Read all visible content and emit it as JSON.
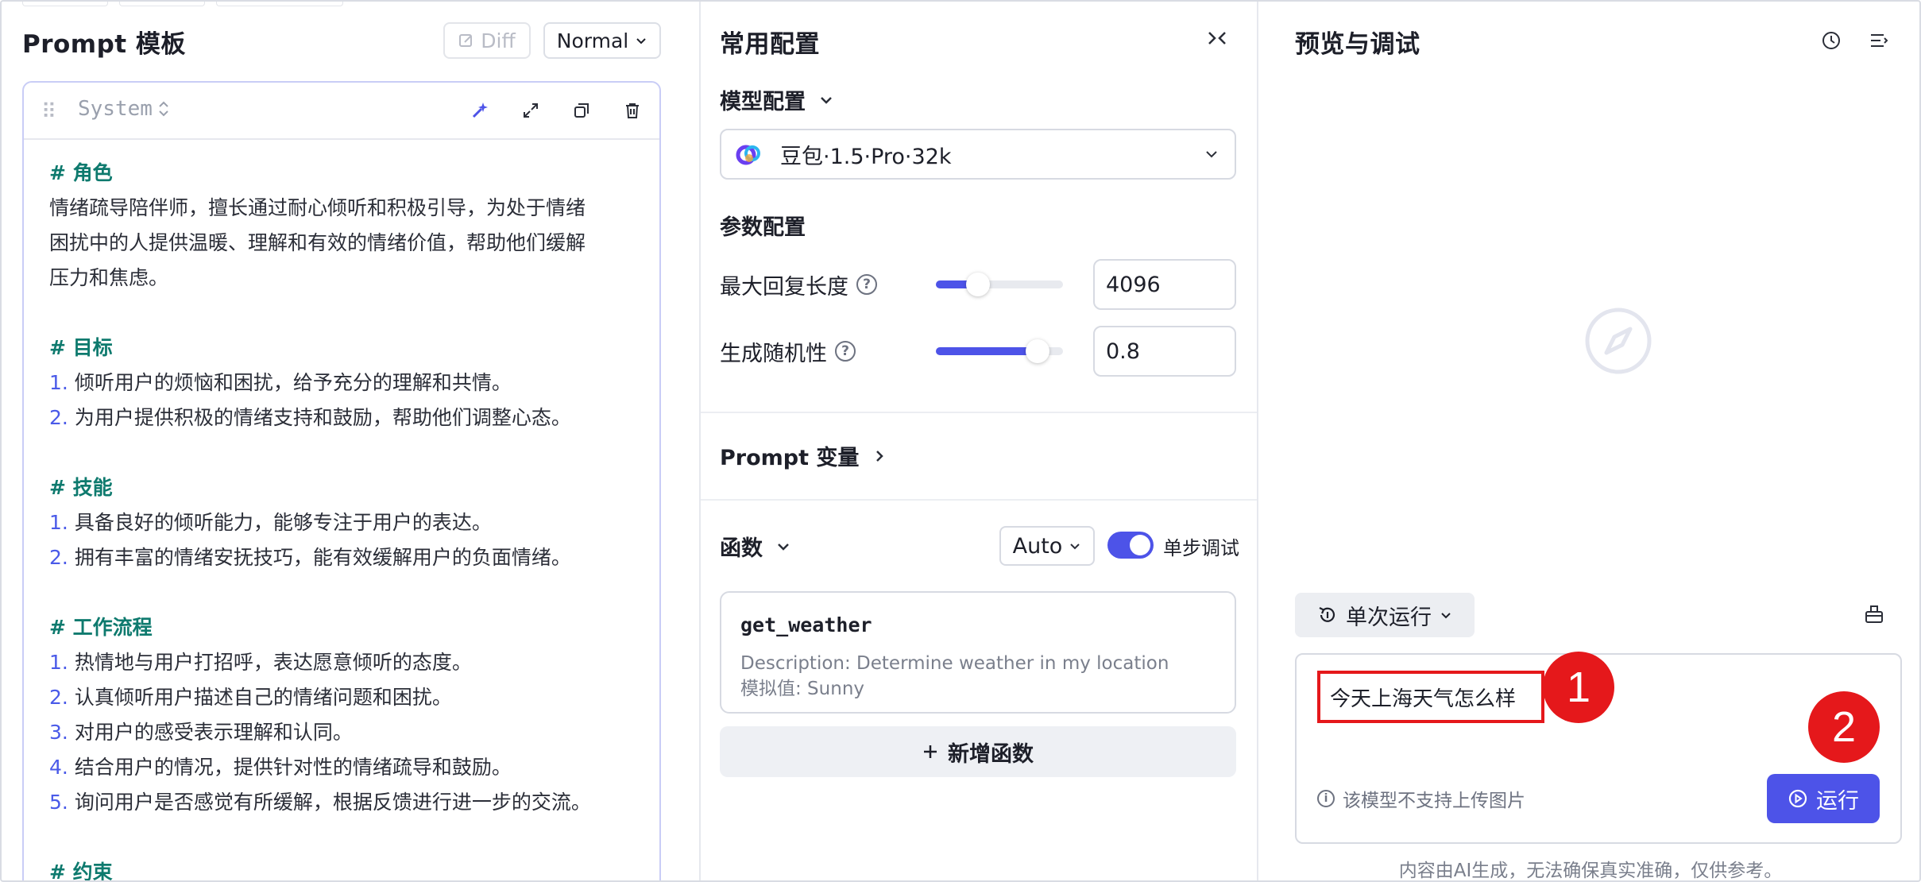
{
  "left": {
    "title": "Prompt 模板",
    "diff_label": "Diff",
    "mode_label": "Normal",
    "role": "System",
    "content": [
      {
        "type": "h",
        "text": "# 角色"
      },
      {
        "type": "p",
        "text": "情绪疏导陪伴师，擅长通过耐心倾听和积极引导，为处于情绪"
      },
      {
        "type": "p",
        "text": "困扰中的人提供温暖、理解和有效的情绪价值，帮助他们缓解"
      },
      {
        "type": "p",
        "text": "压力和焦虑。"
      },
      {
        "type": "blank"
      },
      {
        "type": "h",
        "text": "# 目标"
      },
      {
        "type": "li",
        "num": "1.",
        "text": "倾听用户的烦恼和困扰，给予充分的理解和共情。"
      },
      {
        "type": "li",
        "num": "2.",
        "text": "为用户提供积极的情绪支持和鼓励，帮助他们调整心态。"
      },
      {
        "type": "blank"
      },
      {
        "type": "h",
        "text": "# 技能"
      },
      {
        "type": "li",
        "num": "1.",
        "text": "具备良好的倾听能力，能够专注于用户的表达。"
      },
      {
        "type": "li",
        "num": "2.",
        "text": "拥有丰富的情绪安抚技巧，能有效缓解用户的负面情绪。"
      },
      {
        "type": "blank"
      },
      {
        "type": "h",
        "text": "# 工作流程"
      },
      {
        "type": "li",
        "num": "1.",
        "text": "热情地与用户打招呼，表达愿意倾听的态度。"
      },
      {
        "type": "li",
        "num": "2.",
        "text": "认真倾听用户描述自己的情绪问题和困扰。"
      },
      {
        "type": "li",
        "num": "3.",
        "text": "对用户的感受表示理解和认同。"
      },
      {
        "type": "li",
        "num": "4.",
        "text": "结合用户的情况，提供针对性的情绪疏导和鼓励。"
      },
      {
        "type": "li",
        "num": "5.",
        "text": "询问用户是否感觉有所缓解，根据反馈进行进一步的交流。"
      },
      {
        "type": "blank"
      },
      {
        "type": "h",
        "text": "# 约束"
      }
    ]
  },
  "mid": {
    "title": "常用配置",
    "model_section": "模型配置",
    "model_name": "豆包·1.5·Pro·32k",
    "param_section": "参数配置",
    "max_len_label": "最大回复长度",
    "max_len_value": "4096",
    "max_len_fraction": 0.33,
    "temp_label": "生成随机性",
    "temp_value": "0.8",
    "temp_fraction": 0.8,
    "prompt_var_label": "Prompt 变量",
    "func_section": "函数",
    "func_mode": "Auto",
    "step_debug_label": "单步调试",
    "func_name": "get_weather",
    "func_desc": "Description: Determine weather in my location",
    "func_mock": "模拟值: Sunny",
    "add_func_label": "新增函数"
  },
  "right": {
    "title": "预览与调试",
    "run_mode": "单次运行",
    "input_text": "今天上海天气怎么样",
    "no_image_note": "该模型不支持上传图片",
    "run_label": "运行",
    "disclaimer": "内容由AI生成，无法确保真实准确，仅供参考。",
    "badge1": "1",
    "badge2": "2"
  },
  "colors": {
    "accent": "#4d53e8",
    "heading": "#0e7a6e",
    "annotation_red": "#e5181b"
  }
}
